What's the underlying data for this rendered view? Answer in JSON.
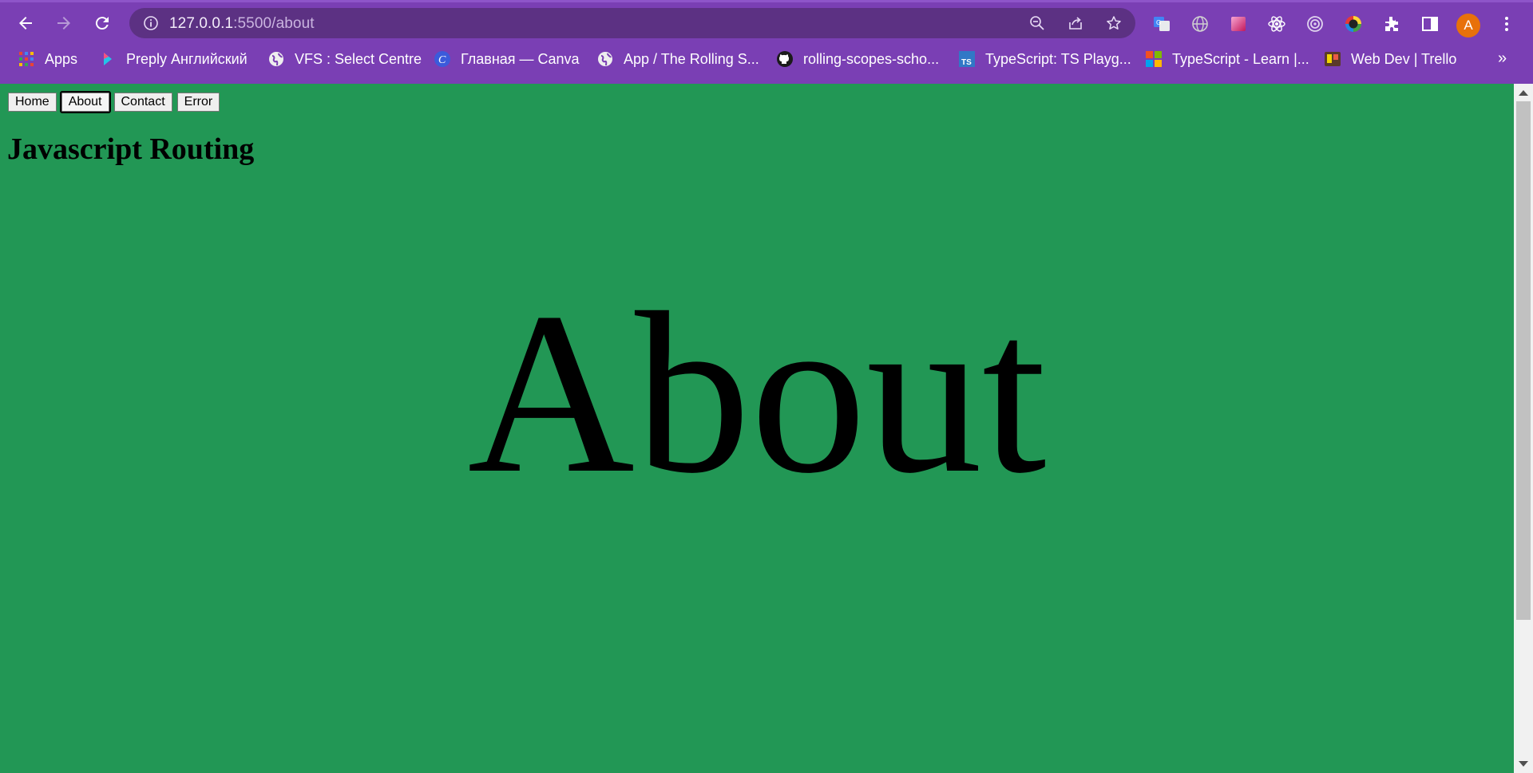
{
  "browser": {
    "url_host": "127.0.0.1",
    "url_path": ":5500/about",
    "profile_initial": "A",
    "bookmarks": [
      {
        "label": "Apps",
        "icon": "apps-grid-icon"
      },
      {
        "label": "Preply Английский",
        "icon": "preply-icon"
      },
      {
        "label": "VFS : Select Centre",
        "icon": "globe-icon"
      },
      {
        "label": "Главная — Canva",
        "icon": "canva-icon"
      },
      {
        "label": "App / The Rolling S...",
        "icon": "globe-icon"
      },
      {
        "label": "rolling-scopes-scho...",
        "icon": "github-icon"
      },
      {
        "label": "TypeScript: TS Playg...",
        "icon": "typescript-icon"
      },
      {
        "label": "TypeScript - Learn |...",
        "icon": "microsoft-icon"
      },
      {
        "label": "Web Dev | Trello",
        "icon": "trello-icon"
      }
    ],
    "bookmarks_overflow": "»"
  },
  "page": {
    "nav": [
      {
        "label": "Home",
        "active": false
      },
      {
        "label": "About",
        "active": true
      },
      {
        "label": "Contact",
        "active": false
      },
      {
        "label": "Error",
        "active": false
      }
    ],
    "site_title": "Javascript Routing",
    "heading": "About",
    "background_color": "#229755"
  }
}
